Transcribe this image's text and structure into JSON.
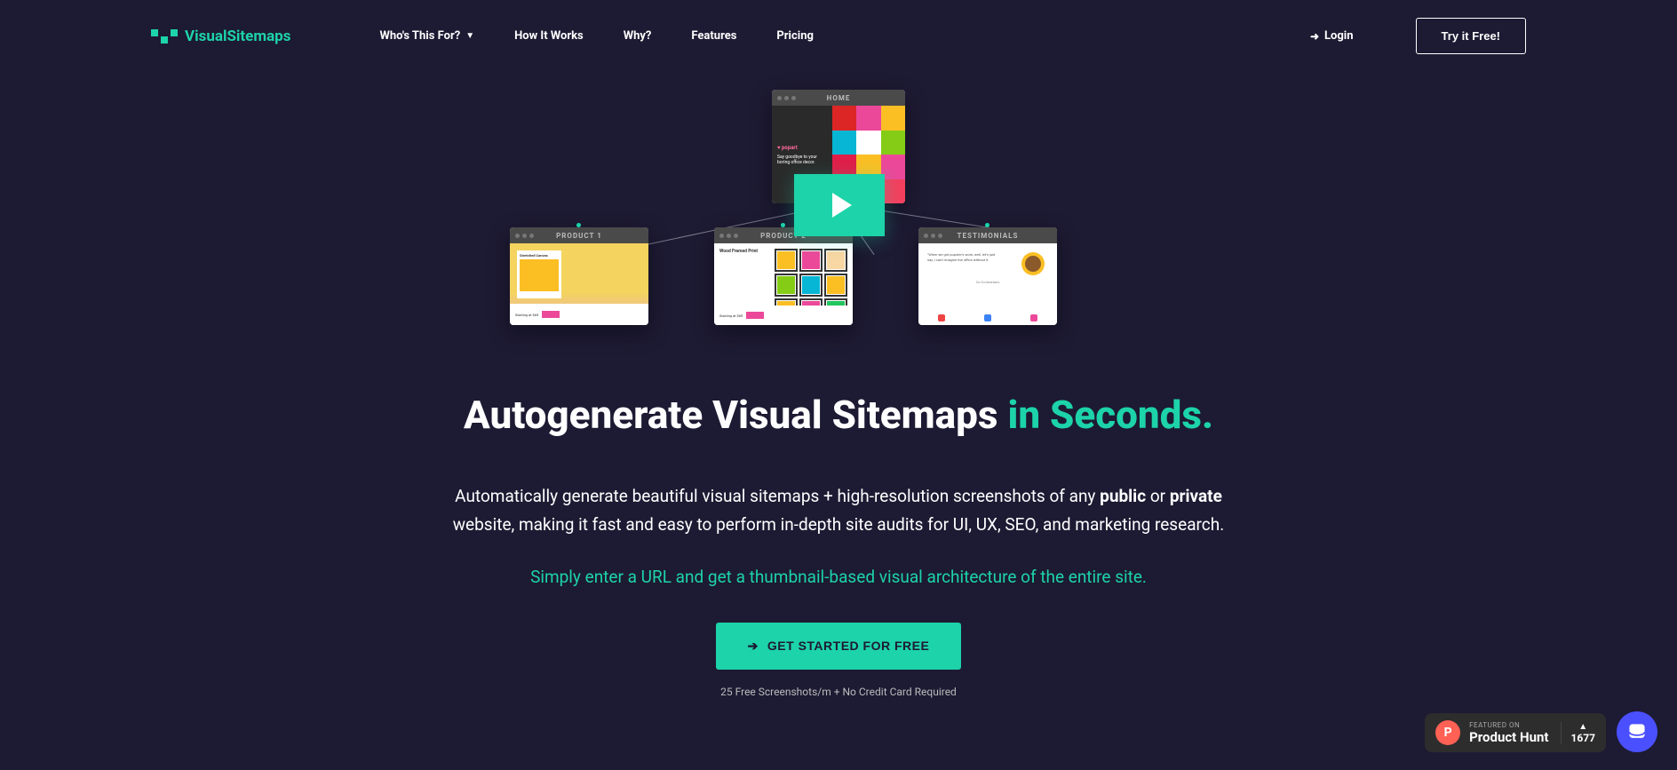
{
  "brand": "VisualSitemaps",
  "nav": {
    "items": [
      {
        "label": "Who's This For?",
        "hasChevron": true
      },
      {
        "label": "How It Works",
        "hasChevron": false
      },
      {
        "label": "Why?",
        "hasChevron": false
      },
      {
        "label": "Features",
        "hasChevron": false
      },
      {
        "label": "Pricing",
        "hasChevron": false
      }
    ],
    "login": "Login",
    "tryFree": "Try it Free!"
  },
  "diagram": {
    "home": "HOME",
    "product1": "PRODUCT 1",
    "product2": "PRODUCT 2",
    "testimonials": "TESTIMONIALS",
    "prod1Label": "Stretched Canvas",
    "prod2Label": "Wood Framed Print"
  },
  "headline": {
    "main": "Autogenerate Visual Sitemaps ",
    "accent": "in Seconds."
  },
  "subtext": {
    "part1": "Automatically generate beautiful visual sitemaps + high-resolution screenshots of any ",
    "bold1": "public",
    "part2": " or ",
    "bold2": "private",
    "part3": " website, making it fast and easy to perform in-depth site audits for UI, UX, SEO, and marketing research."
  },
  "tagline": "Simply enter a URL and get a thumbnail-based visual architecture of the entire site.",
  "cta": {
    "button": "GET STARTED FOR FREE",
    "sub": "25 Free Screenshots/m + No Credit Card Required"
  },
  "productHunt": {
    "featured": "FEATURED ON",
    "name": "Product Hunt",
    "votes": "1677"
  }
}
